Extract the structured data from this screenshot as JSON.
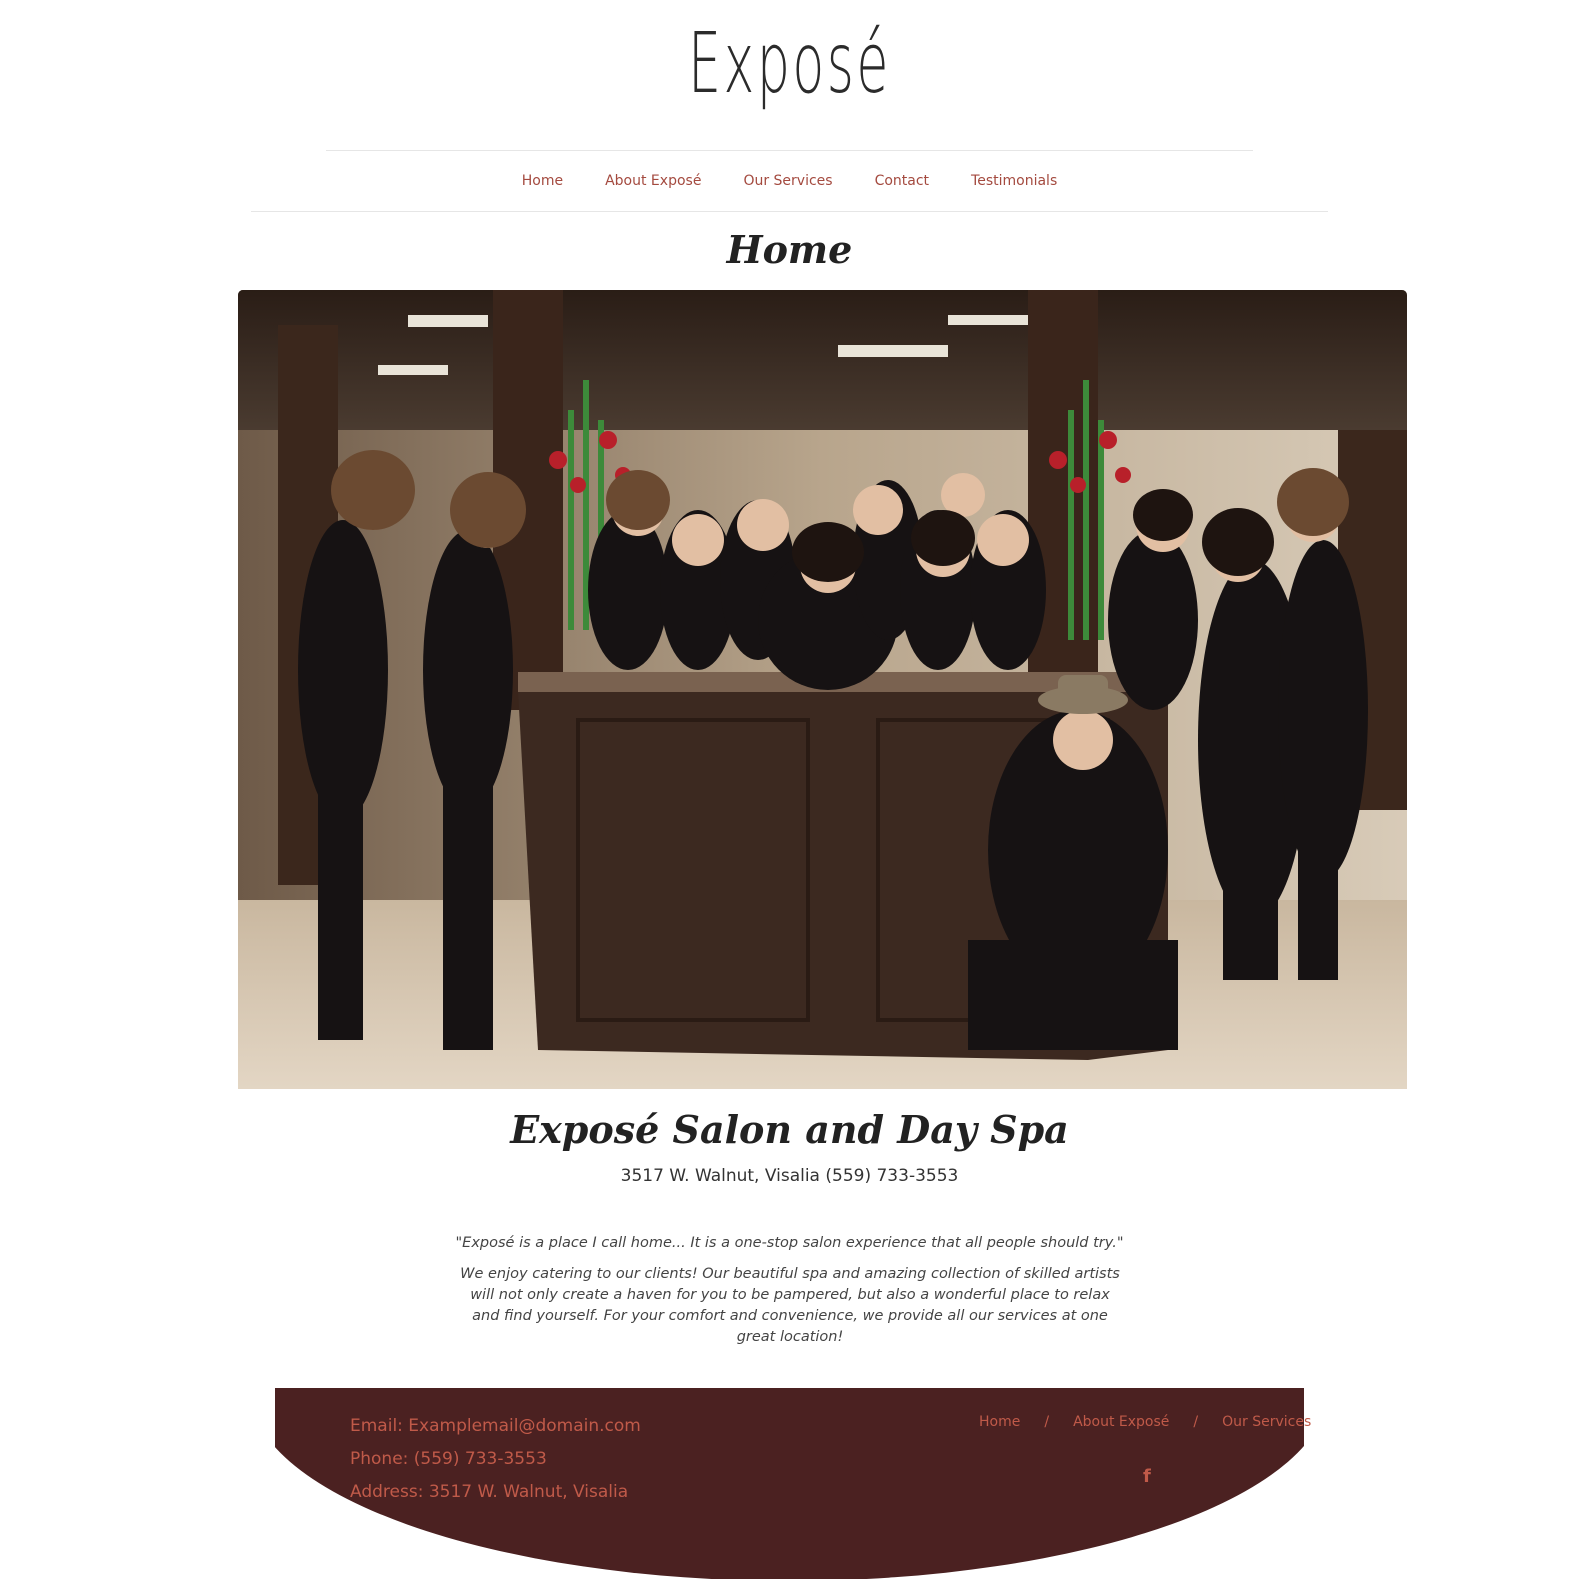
{
  "header": {
    "logo_text": "Exposé"
  },
  "nav": {
    "items": [
      {
        "label": "Home"
      },
      {
        "label": "About Exposé"
      },
      {
        "label": "Our Services"
      },
      {
        "label": "Contact"
      },
      {
        "label": "Testimonials"
      }
    ]
  },
  "main": {
    "page_title": "Home",
    "salon_name": "Exposé Salon and Day Spa",
    "address_line": "3517 W. Walnut, Visalia (559) 733-3553",
    "quote": "\"Exposé is a place I call home... It is a one-stop salon experience that all people should try.\"",
    "paragraph": "We enjoy catering to our clients! Our beautiful spa and amazing collection of skilled artists will not only create a haven for you to be pampered, but also a wonderful place to relax and find yourself. For your comfort and convenience, we provide all our services at one great location!"
  },
  "footer": {
    "email": "Email: Examplemail@domain.com",
    "phone": "Phone: (559) 733-3553",
    "address": "Address: 3517 W. Walnut, Visalia",
    "nav": [
      {
        "label": "Home"
      },
      {
        "label": "About Exposé"
      },
      {
        "label": "Our Services"
      }
    ],
    "separator": "/",
    "facebook_icon_glyph": "f"
  },
  "colors": {
    "accent": "#a44a3f",
    "footer_bg": "#4b2121",
    "footer_text": "#c05a49"
  }
}
